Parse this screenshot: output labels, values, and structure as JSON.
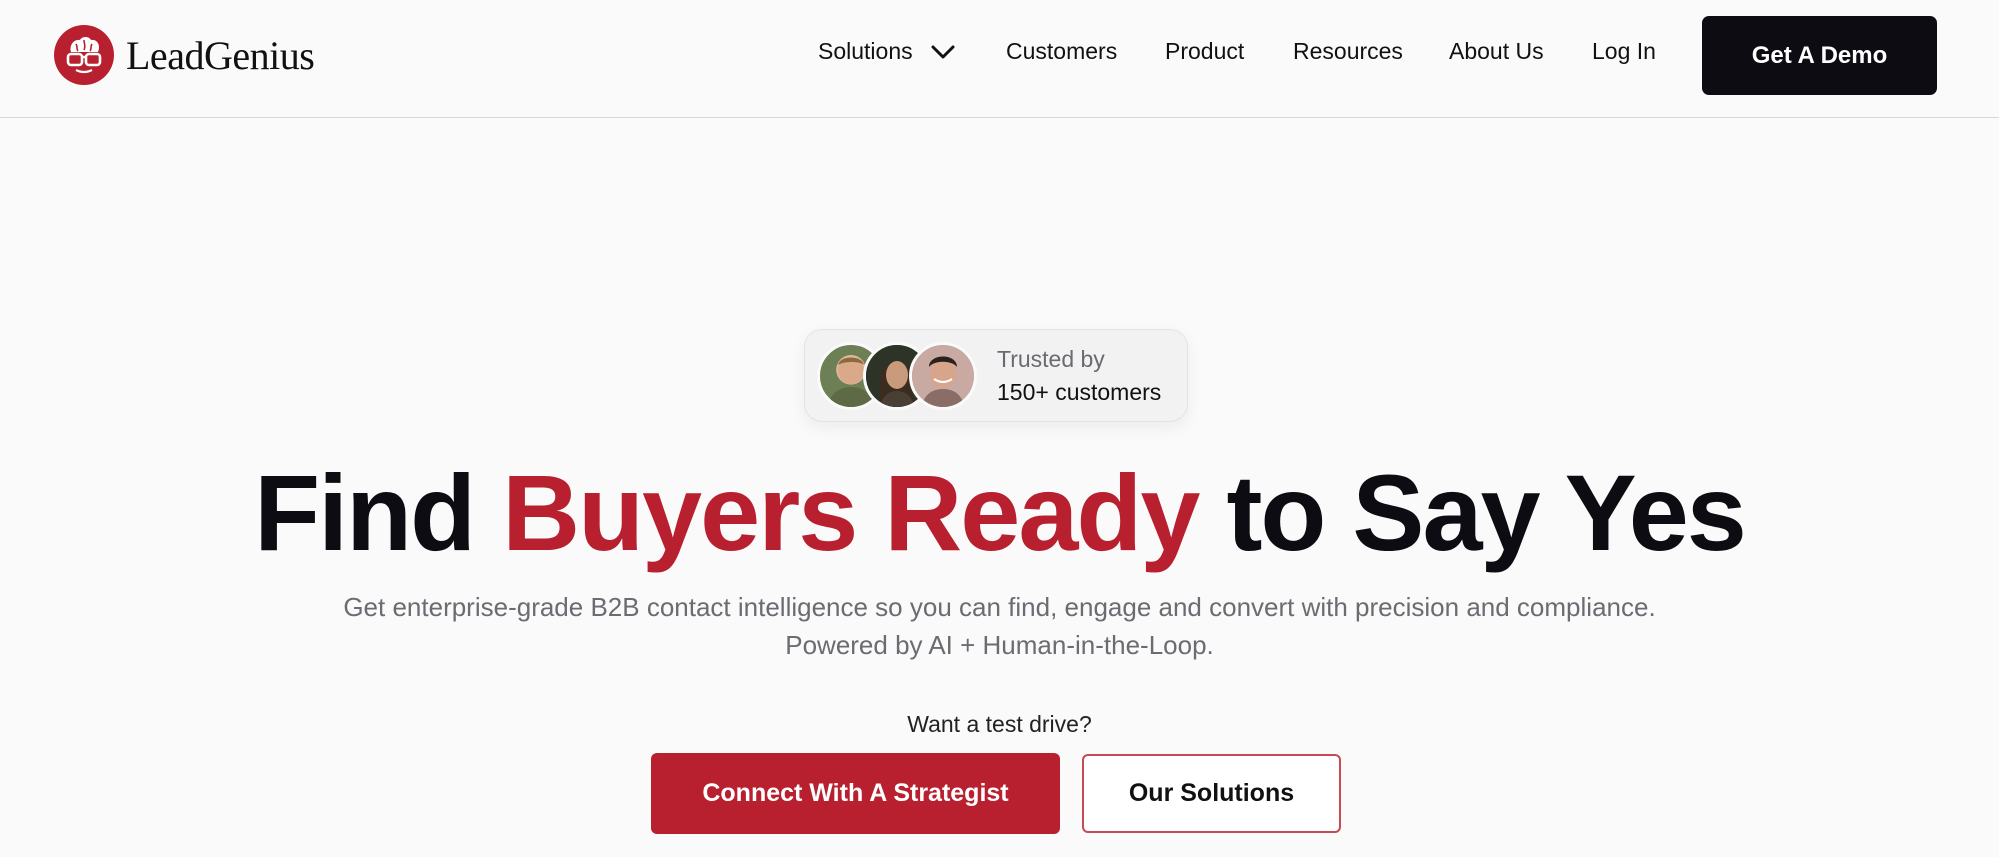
{
  "brand": {
    "name": "LeadGenius",
    "logo_icon": "brain-with-glasses-icon",
    "accent_color": "#b8202f",
    "dark_color": "#0c0c12"
  },
  "nav": {
    "solutions": "Solutions",
    "customers": "Customers",
    "product": "Product",
    "resources": "Resources",
    "about": "About Us",
    "login": "Log In",
    "cta": "Get A Demo"
  },
  "badge": {
    "line1": "Trusted by",
    "line2": "150+ customers",
    "avatars": [
      "customer-avatar",
      "customer-avatar",
      "customer-avatar"
    ]
  },
  "hero": {
    "headline_start": "Find",
    "headline_accent": "Buyers Ready",
    "headline_end": "to Say Yes",
    "subtitle": "Get enterprise-grade B2B contact intelligence so you can find, engage and convert with precision and compliance. Powered by AI + Human-in-the-Loop.",
    "prompt": "Want a test drive?",
    "primary_cta": "Connect With A Strategist",
    "secondary_cta": "Our Solutions"
  }
}
